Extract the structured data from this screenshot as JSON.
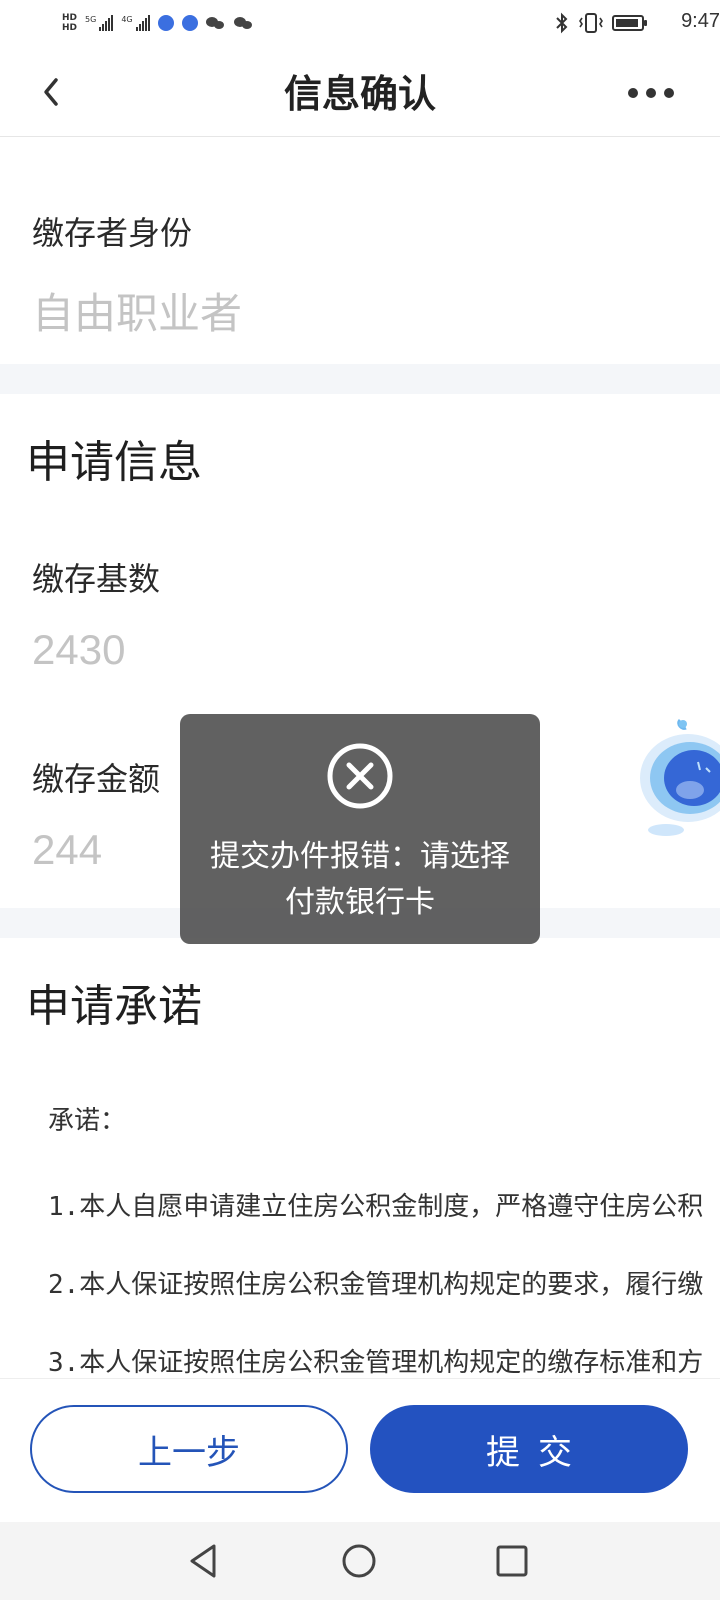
{
  "status_bar": {
    "hd_top": "HD",
    "hd_bottom": "HD",
    "net1": "5G",
    "net2": "4G",
    "time": "9:47",
    "battery_level": 0.9,
    "icons": [
      "signal-icon",
      "signal-icon",
      "app-icon",
      "app-icon",
      "wechat-icon",
      "wechat-icon",
      "bluetooth-icon",
      "vibrate-icon",
      "battery-icon"
    ]
  },
  "header": {
    "title": "信息确认",
    "back_icon": "chevron-left-icon",
    "more_icon": "more-icon"
  },
  "identity": {
    "label": "缴存者身份",
    "value": "自由职业者"
  },
  "apply_info": {
    "title": "申请信息",
    "base_label": "缴存基数",
    "base_value": "2430",
    "amount_label": "缴存金额",
    "amount_value": "244"
  },
  "promise": {
    "title": "申请承诺",
    "heading": "承诺：",
    "lines": [
      "1.本人自愿申请建立住房公积金制度，严格遵守住房公积",
      "2.本人保证按照住房公积金管理机构规定的要求，履行缴",
      "3.本人保证按照住房公积金管理机构规定的缴存标准和方"
    ]
  },
  "actions": {
    "prev_label": "上一步",
    "submit_label": "提交"
  },
  "toast": {
    "icon": "close-circle-icon",
    "message": "提交办件报错：请选择付款银行卡"
  },
  "nav": {
    "back": "nav-back-icon",
    "home": "nav-home-icon",
    "recent": "nav-recent-icon"
  },
  "colors": {
    "primary": "#2352C0",
    "placeholder": "#C4C4C4",
    "toast_bg": "#505050"
  }
}
